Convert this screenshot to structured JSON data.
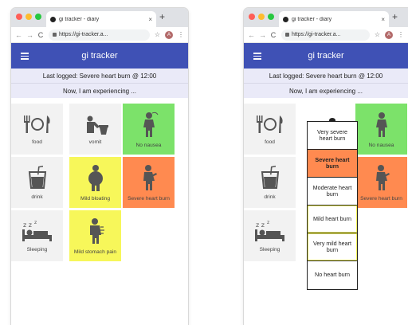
{
  "browser": {
    "tab_title": "gi tracker - diary",
    "tab_close": "×",
    "new_tab": "+",
    "back": "←",
    "forward": "→",
    "reload": "C",
    "url": "https://gi-tracker.a...",
    "bookmark": "☆",
    "profile_initial": "A",
    "menu": "⋮"
  },
  "app": {
    "title": "gi tracker",
    "status": "Last logged: Severe heart burn @ 12:00",
    "prompt": "Now, I am experiencing ..."
  },
  "tiles": [
    {
      "label": "food",
      "icon": "food-icon",
      "color": "#f2f2f2"
    },
    {
      "label": "vomit",
      "icon": "vomit-icon",
      "color": "#f2f2f2"
    },
    {
      "label": "No nausea",
      "icon": "nausea-icon",
      "color": "#7ce26a"
    },
    {
      "label": "drink",
      "icon": "drink-icon",
      "color": "#f2f2f2"
    },
    {
      "label": "Mild bloating",
      "icon": "bloating-icon",
      "color": "#f7f75a"
    },
    {
      "label": "Severe heart burn",
      "icon": "heartburn-icon",
      "color": "#ff8a50"
    },
    {
      "label": "Sleeping",
      "icon": "sleeping-icon",
      "color": "#f2f2f2"
    },
    {
      "label": "Mild stomach pain",
      "icon": "stomach-pain-icon",
      "color": "#f7f75a"
    }
  ],
  "heartburn_options": [
    {
      "label": "Very severe heart burn",
      "selected": false
    },
    {
      "label": "Severe heart burn",
      "selected": true
    },
    {
      "label": "Moderate heart burn",
      "selected": false
    },
    {
      "label": "Mild heart burn",
      "selected": false
    },
    {
      "label": "Very mild heart burn",
      "selected": false
    },
    {
      "label": "No heart burn",
      "selected": false
    }
  ],
  "colors": {
    "appbar": "#3f51b5",
    "green": "#7ce26a",
    "yellow": "#f7f75a",
    "orange": "#ff8a50"
  }
}
